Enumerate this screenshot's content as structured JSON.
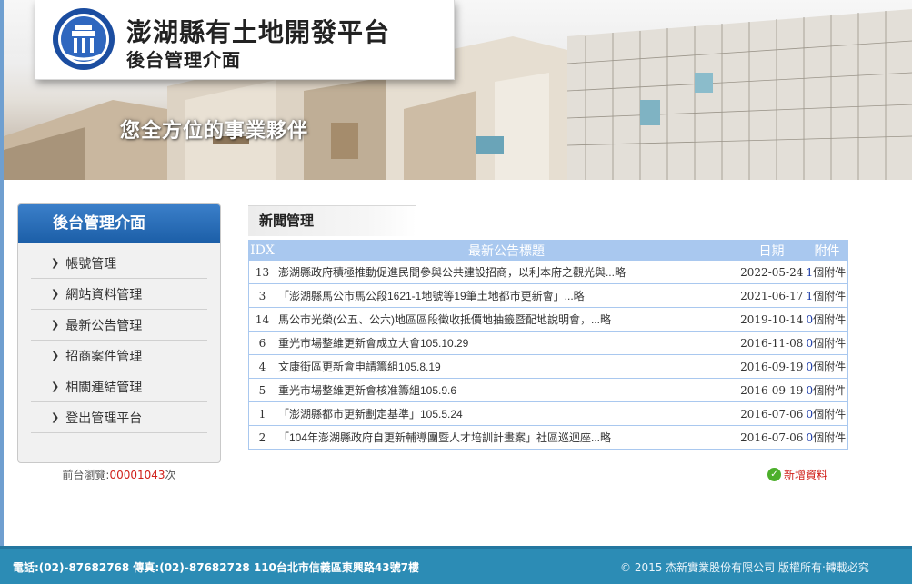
{
  "header": {
    "site_title": "澎湖縣有土地開發平台",
    "site_subtitle": "後台管理介面",
    "slogan": "您全方位的事業夥伴",
    "logo_icon": "county-emblem-icon"
  },
  "sidebar": {
    "title": "後台管理介面",
    "items": [
      {
        "label": "帳號管理"
      },
      {
        "label": "網站資料管理"
      },
      {
        "label": "最新公告管理"
      },
      {
        "label": "招商案件管理"
      },
      {
        "label": "相關連結管理"
      },
      {
        "label": "登出管理平台"
      }
    ],
    "visits_label": "前台瀏覽:",
    "visits_count": "00001043",
    "visits_suffix": "次"
  },
  "main": {
    "tab_title": "新聞管理",
    "columns": {
      "idx": "IDX",
      "title": "最新公告標題",
      "date": "日期",
      "attachments": "附件"
    },
    "rows": [
      {
        "idx": "13",
        "title": "澎湖縣政府積極推動促進民間參與公共建設招商，以利本府之觀光與...略",
        "date": "2022-05-24",
        "att_count": "1",
        "att_label": "個附件"
      },
      {
        "idx": "3",
        "title": "「澎湖縣馬公市馬公段1621-1地號等19筆土地都市更新會」...略",
        "date": "2021-06-17",
        "att_count": "1",
        "att_label": "個附件"
      },
      {
        "idx": "14",
        "title": "馬公市光榮(公五、公六)地區區段徵收抵價地抽籤暨配地說明會，...略",
        "date": "2019-10-14",
        "att_count": "0",
        "att_label": "個附件"
      },
      {
        "idx": "6",
        "title": "重光市場整維更新會成立大會105.10.29",
        "date": "2016-11-08",
        "att_count": "0",
        "att_label": "個附件"
      },
      {
        "idx": "4",
        "title": "文康街區更新會申請籌組105.8.19",
        "date": "2016-09-19",
        "att_count": "0",
        "att_label": "個附件"
      },
      {
        "idx": "5",
        "title": "重光市場整維更新會核准籌組105.9.6",
        "date": "2016-09-19",
        "att_count": "0",
        "att_label": "個附件"
      },
      {
        "idx": "1",
        "title": "「澎湖縣都市更新劃定基準」105.5.24",
        "date": "2016-07-06",
        "att_count": "0",
        "att_label": "個附件"
      },
      {
        "idx": "2",
        "title": "「104年澎湖縣政府自更新輔導團暨人才培訓計畫案」社區巡迴座...略",
        "date": "2016-07-06",
        "att_count": "0",
        "att_label": "個附件"
      }
    ],
    "add_label": "新增資料"
  },
  "footer": {
    "contact": "電話:(02)-87682768 傳真:(02)-87682728 110台北市信義區東興路43號7樓",
    "copyright": "© 2015 杰新實業股份有限公司 版權所有‧轉載必究"
  },
  "colors": {
    "accent_blue": "#1c5fa8",
    "table_header": "#a9c8ef",
    "footer_bg": "#2c8cb5",
    "counter_red": "#d0201a"
  }
}
